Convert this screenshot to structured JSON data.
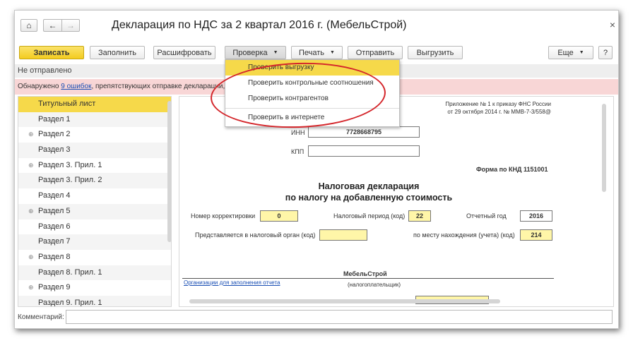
{
  "window": {
    "title": "Декларация по НДС за 2 квартал 2016 г. (МебельСтрой)",
    "nav": {
      "home_icon": "⌂",
      "back_icon": "←",
      "forward_icon": "→"
    },
    "close_icon": "×"
  },
  "toolbar": {
    "save_label": "Записать",
    "fill_label": "Заполнить",
    "decode_label": "Расшифровать",
    "check_label": "Проверка",
    "print_label": "Печать",
    "send_label": "Отправить",
    "export_label": "Выгрузить",
    "more_label": "Еще",
    "help_label": "?",
    "caret": "▼"
  },
  "status": {
    "text": "Не отправлено",
    "error_prefix": "Обнаружено ",
    "error_link": "9 ошибок",
    "error_suffix": ", препятствующих отправке декларации, и"
  },
  "check_menu": {
    "items": [
      {
        "label": "Проверить выгрузку"
      },
      {
        "label": "Проверить контрольные соотношения"
      },
      {
        "label": "Проверить контрагентов"
      },
      {
        "label": "Проверить в интернете"
      }
    ]
  },
  "tree": {
    "expander_icon": "⊕",
    "items": [
      {
        "label": "Титульный лист"
      },
      {
        "label": "Раздел 1"
      },
      {
        "label": "Раздел 2"
      },
      {
        "label": "Раздел 3"
      },
      {
        "label": "Раздел 3. Прил. 1"
      },
      {
        "label": "Раздел 3. Прил. 2"
      },
      {
        "label": "Раздел 4"
      },
      {
        "label": "Раздел 5"
      },
      {
        "label": "Раздел 6"
      },
      {
        "label": "Раздел 7"
      },
      {
        "label": "Раздел 8"
      },
      {
        "label": "Раздел 8. Прил. 1"
      },
      {
        "label": "Раздел 9"
      },
      {
        "label": "Раздел 9. Прил. 1"
      }
    ]
  },
  "form": {
    "appendix_line1": "Приложение № 1 к приказу ФНС России",
    "appendix_line2": "от 29 октября 2014 г. № ММВ-7-3/558@",
    "inn_label": "ИНН",
    "inn_value": "7728668795",
    "kpp_label": "КПП",
    "kpp_value": "",
    "knd": "Форма по КНД 1151001",
    "heading_line1": "Налоговая декларация",
    "heading_line2": "по налогу на добавленную стоимость",
    "correction_label": "Номер корректировки",
    "correction_value": "0",
    "period_label": "Налоговый период (код)",
    "period_value": "22",
    "year_label": "Отчетный год",
    "year_value": "2016",
    "authority_label": "Представляется в налоговый орган (код)",
    "authority_value": "",
    "location_label": "по месту нахождения (учета) (код)",
    "location_value": "214",
    "org_name": "МебельСтрой",
    "org_link": "Организации для заполнения отчета",
    "taxpayer_label": "(налогоплательщик)"
  },
  "comment": {
    "label": "Комментарий:",
    "value": ""
  }
}
